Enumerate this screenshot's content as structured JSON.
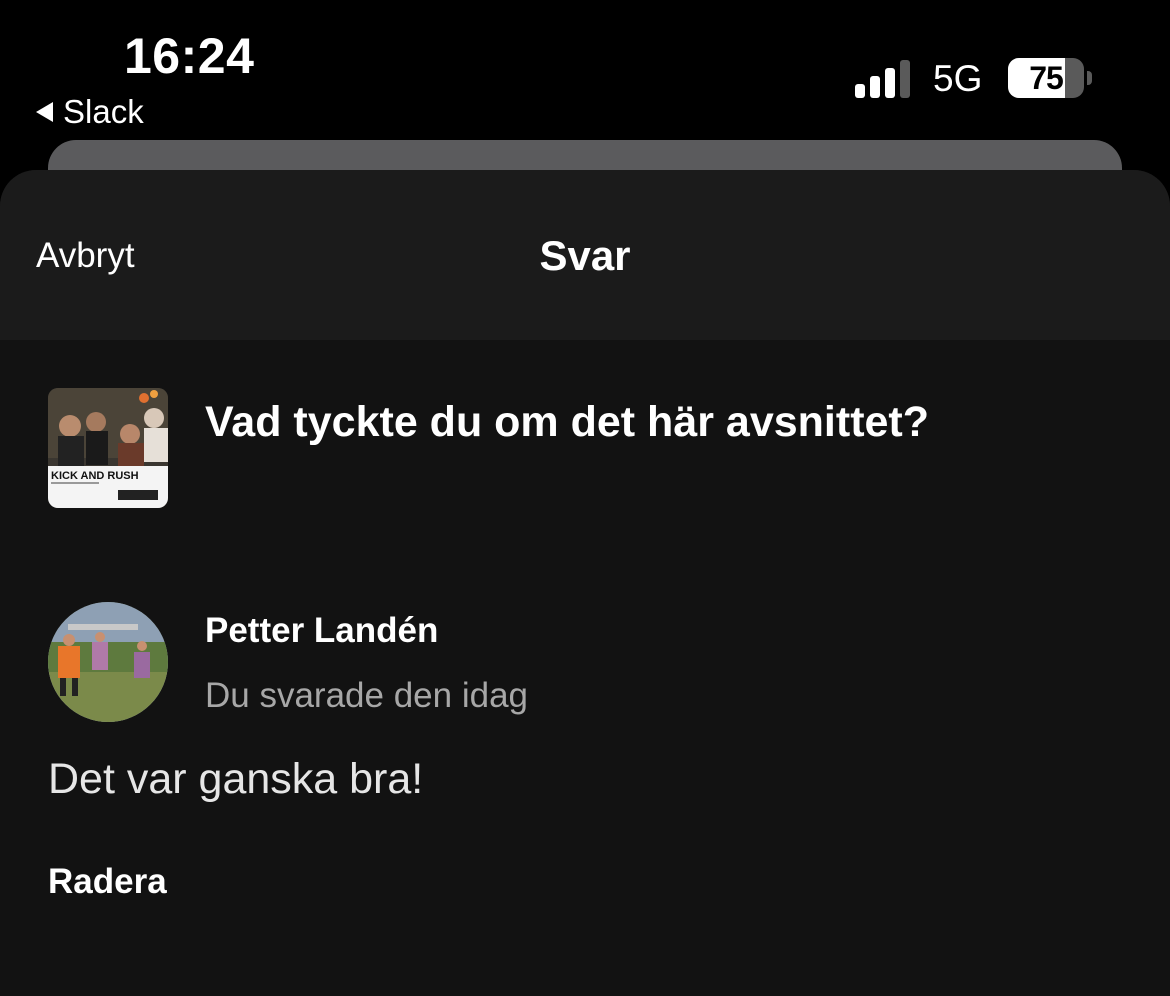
{
  "status_bar": {
    "time": "16:24",
    "back_app": "Slack",
    "network": "5G",
    "battery_percent": 75,
    "battery_label": "75",
    "signal_bars_active": 3,
    "signal_bars_total": 4
  },
  "nav": {
    "cancel_label": "Avbryt",
    "title": "Svar"
  },
  "episode": {
    "question": "Vad tyckte du om det här avsnittet?",
    "thumbnail_text": "KICK AND RUSH"
  },
  "reply": {
    "author": "Petter Landén",
    "meta": "Du svarade den idag",
    "text": "Det var ganska bra!",
    "delete_label": "Radera"
  },
  "colors": {
    "background": "#000000",
    "sheet": "#121212",
    "nav_bar": "#1b1b1b",
    "secondary_text": "#a7a7a7"
  }
}
